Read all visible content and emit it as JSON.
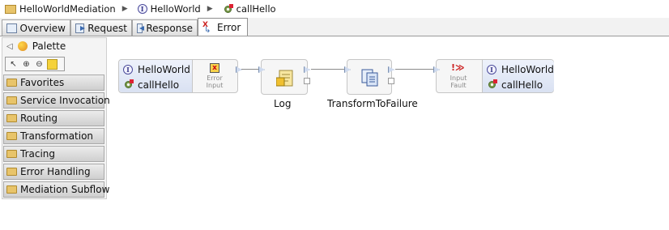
{
  "breadcrumb": {
    "items": [
      {
        "label": "HelloWorldMediation",
        "icon": "folder-icon"
      },
      {
        "label": "HelloWorld",
        "icon": "interface-icon"
      },
      {
        "label": "callHello",
        "icon": "operation-icon"
      }
    ]
  },
  "tabs": [
    {
      "label": "Overview",
      "icon": "overview-icon"
    },
    {
      "label": "Request",
      "icon": "request-icon"
    },
    {
      "label": "Response",
      "icon": "response-icon"
    },
    {
      "label": "Error",
      "icon": "error-icon",
      "active": true
    }
  ],
  "palette": {
    "title": "Palette",
    "drawers": [
      "Favorites",
      "Service Invocation",
      "Routing",
      "Transformation",
      "Tracing",
      "Error Handling",
      "Mediation Subflow"
    ]
  },
  "flow": {
    "input_node": {
      "interface": "HelloWorld",
      "operation": "callHello",
      "terminal_label": "Error Input"
    },
    "primitives": [
      {
        "name": "Log",
        "icon": "log-icon"
      },
      {
        "name": "TransformToFailure",
        "icon": "xsl-transform-icon"
      }
    ],
    "output_node": {
      "interface": "HelloWorld",
      "operation": "callHello",
      "terminal_label": "Input Fault"
    }
  },
  "colors": {
    "accent_port": "#cdd9ee",
    "folder": "#e8c46a",
    "error_red": "#cc2222"
  }
}
